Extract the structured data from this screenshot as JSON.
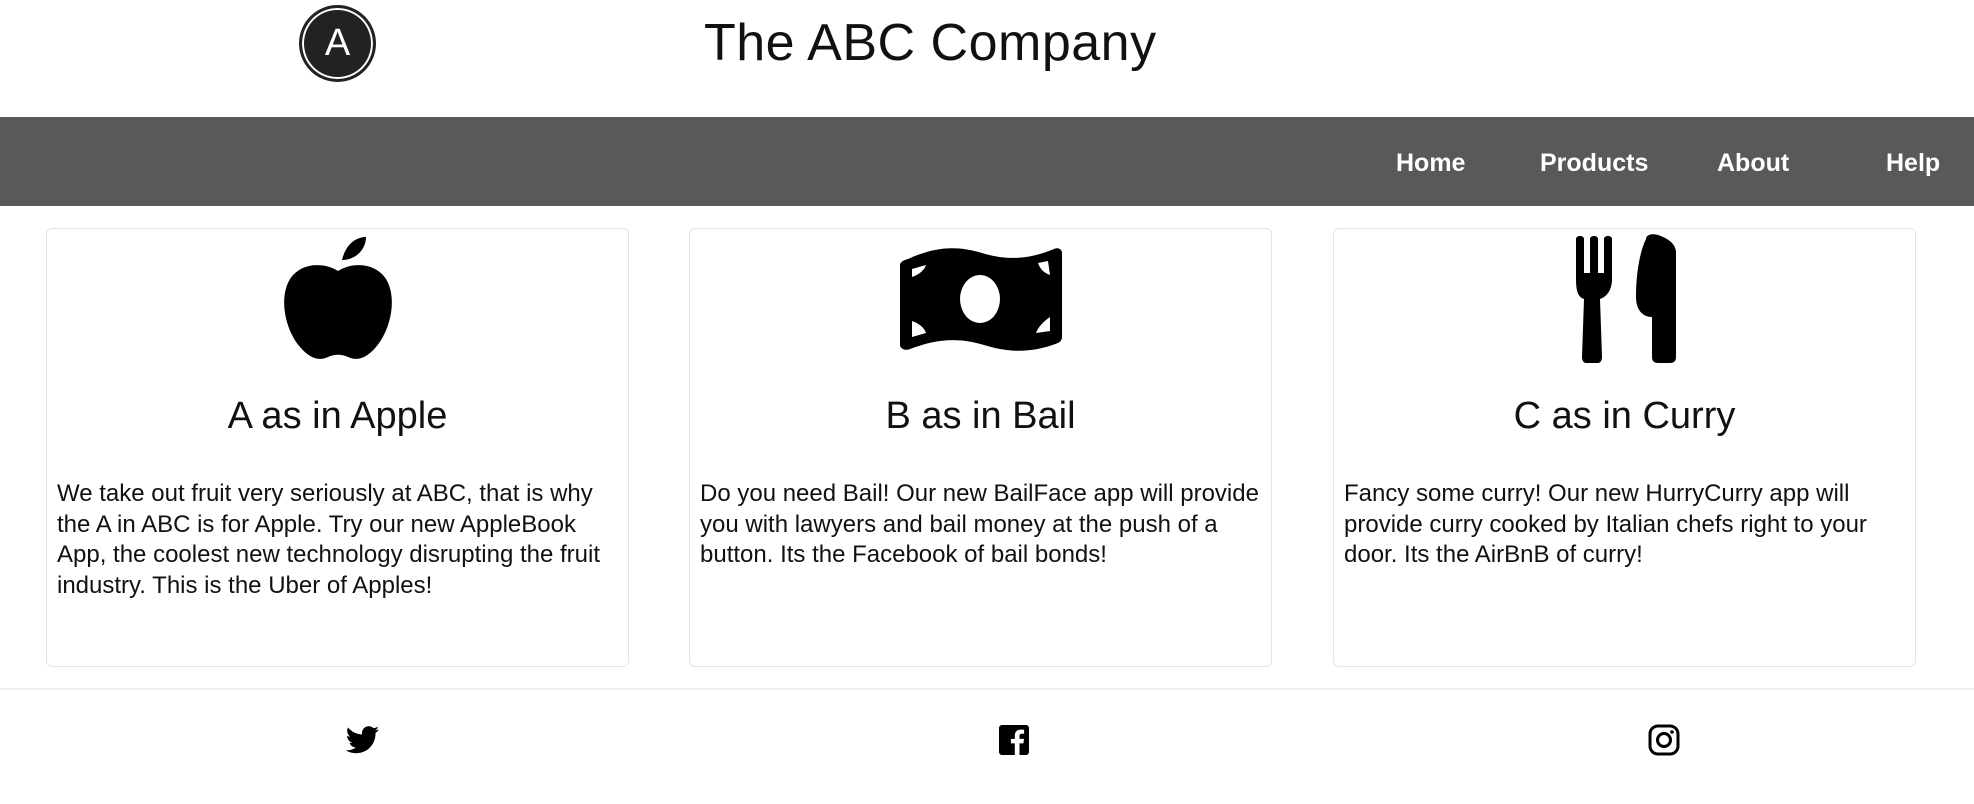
{
  "header": {
    "logo_letter": "A",
    "title": "The ABC Company"
  },
  "nav": {
    "items": [
      {
        "label": "Home"
      },
      {
        "label": "Products"
      },
      {
        "label": "About"
      },
      {
        "label": "Help"
      }
    ],
    "background_color": "#595959",
    "text_color": "#ffffff"
  },
  "cards": [
    {
      "icon": "apple-icon",
      "title": "A as in Apple",
      "body": "We take out fruit very seriously at ABC, that is why the A in ABC is for Apple. Try our new AppleBook App, the coolest new technology disrupting the fruit industry. This is the Uber of Apples!"
    },
    {
      "icon": "money-bill-icon",
      "title": "B as in Bail",
      "body": "Do you need Bail! Our new BailFace app will provide you with lawyers and bail money at the push of a button. Its the Facebook of bail bonds!"
    },
    {
      "icon": "fork-knife-icon",
      "title": "C as in Curry",
      "body": "Fancy some curry! Our new HurryCurry app will provide curry cooked by Italian chefs right to your door. Its the AirBnB of curry!"
    }
  ],
  "footer": {
    "social_icons": [
      "twitter-icon",
      "facebook-icon",
      "instagram-icon"
    ]
  }
}
